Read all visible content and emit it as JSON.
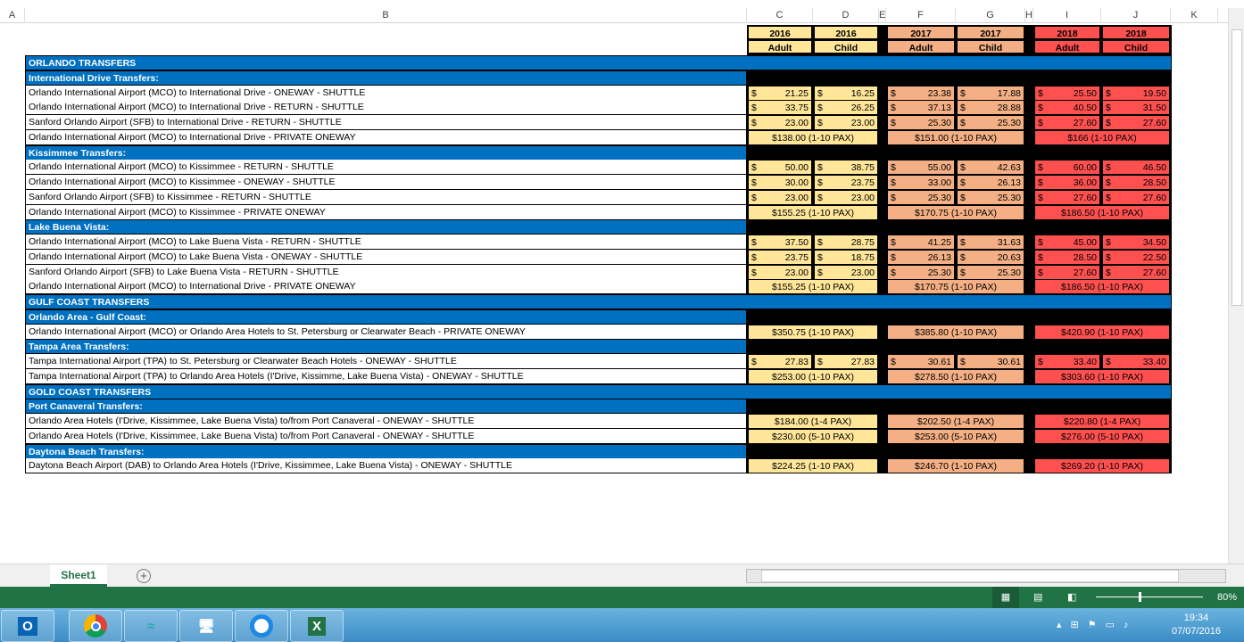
{
  "columns": [
    "A",
    "B",
    "C",
    "D",
    "E",
    "F",
    "G",
    "H",
    "I",
    "J",
    "K"
  ],
  "header": {
    "years": [
      "2016",
      "2016",
      "2017",
      "2017",
      "2018",
      "2018"
    ],
    "types": [
      "Adult",
      "Child",
      "Adult",
      "Child",
      "Adult",
      "Child"
    ]
  },
  "rows": [
    {
      "type": "section",
      "label": "ORLANDO TRANSFERS"
    },
    {
      "type": "sub",
      "label": "International Drive Transfers:"
    },
    {
      "type": "price",
      "label": "Orlando International Airport (MCO) to International Drive - ONEWAY - SHUTTLE",
      "prices": [
        "21.25",
        "16.25",
        "23.38",
        "17.88",
        "25.50",
        "19.50"
      ]
    },
    {
      "type": "price",
      "label": "Orlando International Airport (MCO) to International Drive - RETURN - SHUTTLE",
      "prices": [
        "33.75",
        "26.25",
        "37.13",
        "28.88",
        "40.50",
        "31.50"
      ]
    },
    {
      "type": "price",
      "label": "Sanford Orlando Airport (SFB) to International Drive - RETURN - SHUTTLE",
      "prices": [
        "23.00",
        "23.00",
        "25.30",
        "25.30",
        "27.60",
        "27.60"
      ]
    },
    {
      "type": "private",
      "label": "Orlando International Airport (MCO) to International Drive - PRIVATE ONEWAY",
      "totals": [
        "$138.00 (1-10 PAX)",
        "$151.00 (1-10 PAX)",
        "$166 (1-10 PAX)"
      ]
    },
    {
      "type": "sub",
      "label": "Kissimmee Transfers:"
    },
    {
      "type": "price",
      "label": "Orlando International Airport (MCO) to Kissimmee - RETURN - SHUTTLE",
      "prices": [
        "50.00",
        "38.75",
        "55.00",
        "42.63",
        "60.00",
        "46.50"
      ]
    },
    {
      "type": "price",
      "label": "Orlando International Airport (MCO) to Kissimmee - ONEWAY - SHUTTLE",
      "prices": [
        "30.00",
        "23.75",
        "33.00",
        "26.13",
        "36.00",
        "28.50"
      ]
    },
    {
      "type": "price",
      "label": "Sanford Orlando Airport (SFB) to Kissimmee - RETURN - SHUTTLE",
      "prices": [
        "23.00",
        "23.00",
        "25.30",
        "25.30",
        "27.60",
        "27.60"
      ]
    },
    {
      "type": "private",
      "label": "Orlando International Airport (MCO) to Kissimmee - PRIVATE ONEWAY",
      "totals": [
        "$155.25 (1-10 PAX)",
        "$170.75 (1-10 PAX)",
        "$186.50 (1-10 PAX)"
      ]
    },
    {
      "type": "sub",
      "label": "Lake Buena Vista:"
    },
    {
      "type": "price",
      "label": "Orlando International Airport (MCO) to Lake Buena Vista - RETURN - SHUTTLE",
      "prices": [
        "37.50",
        "28.75",
        "41.25",
        "31.63",
        "45.00",
        "34.50"
      ]
    },
    {
      "type": "price",
      "label": "Orlando International Airport (MCO) to Lake Buena Vista - ONEWAY - SHUTTLE",
      "prices": [
        "23.75",
        "18.75",
        "26.13",
        "20.63",
        "28.50",
        "22.50"
      ]
    },
    {
      "type": "price",
      "label": "Sanford Orlando Airport (SFB) to Lake Buena Vista - RETURN - SHUTTLE",
      "prices": [
        "23.00",
        "23.00",
        "25.30",
        "25.30",
        "27.60",
        "27.60"
      ]
    },
    {
      "type": "private",
      "label": "Orlando International Airport (MCO) to International Drive - PRIVATE ONEWAY",
      "totals": [
        "$155.25 (1-10 PAX)",
        "$170.75 (1-10 PAX)",
        "$186.50 (1-10 PAX)"
      ]
    },
    {
      "type": "section",
      "label": "GULF COAST TRANSFERS"
    },
    {
      "type": "sub",
      "label": "Orlando Area - Gulf Coast:"
    },
    {
      "type": "private",
      "label": "Orlando International Airport (MCO) or Orlando Area Hotels to St. Petersburg or Clearwater Beach - PRIVATE ONEWAY",
      "totals": [
        "$350.75 (1-10 PAX)",
        "$385.80 (1-10 PAX)",
        "$420.90 (1-10 PAX)"
      ]
    },
    {
      "type": "sub",
      "label": "Tampa Area Transfers:"
    },
    {
      "type": "price",
      "label": "Tampa International Airport (TPA) to St. Petersburg or Clearwater Beach Hotels - ONEWAY - SHUTTLE",
      "prices": [
        "27.83",
        "27.83",
        "30.61",
        "30.61",
        "33.40",
        "33.40"
      ]
    },
    {
      "type": "private",
      "label": "Tampa International Airport (TPA) to Orlando Area Hotels (I'Drive, Kissimme, Lake Buena Vista) - ONEWAY - SHUTTLE",
      "totals": [
        "$253.00 (1-10 PAX)",
        "$278.50 (1-10 PAX)",
        "$303.60 (1-10 PAX)"
      ]
    },
    {
      "type": "section",
      "label": "GOLD COAST TRANSFERS"
    },
    {
      "type": "sub",
      "label": "Port Canaveral Transfers:"
    },
    {
      "type": "private",
      "label": "Orlando Area Hotels (I'Drive, Kissimmee, Lake Buena Vista) to/from Port Canaveral - ONEWAY - SHUTTLE",
      "totals": [
        "$184.00 (1-4 PAX)",
        "$202.50 (1-4 PAX)",
        "$220.80 (1-4 PAX)"
      ]
    },
    {
      "type": "private",
      "label": "Orlando Area Hotels (I'Drive, Kissimmee, Lake Buena Vista) to/from Port Canaveral - ONEWAY - SHUTTLE",
      "totals": [
        "$230.00 (5-10 PAX)",
        "$253.00 (5-10 PAX)",
        "$276.00 (5-10 PAX)"
      ]
    },
    {
      "type": "sub",
      "label": "Daytona Beach Transfers:"
    },
    {
      "type": "private",
      "label": "Daytona Beach Airport (DAB) to Orlando Area Hotels (I'Drive, Kissimmee, Lake Buena Vista) - ONEWAY - SHUTTLE",
      "totals": [
        "$224.25 (1-10 PAX)",
        "$246.70 (1-10 PAX)",
        "$269.20 (1-10 PAX)"
      ]
    }
  ],
  "currency_symbol": "$",
  "colors": {
    "y2016": "#FFE699",
    "y2017": "#F4B084",
    "y2018": "#FF5050",
    "section": "#0070C0",
    "status": "#217346"
  },
  "sheet_tab": "Sheet1",
  "add_sheet": "+",
  "zoom": "80%",
  "clock": {
    "time": "19:34",
    "date": "07/07/2016"
  },
  "taskbar": [
    "outlook",
    "chrome",
    "app",
    "remote-desktop",
    "app-g",
    "excel"
  ]
}
